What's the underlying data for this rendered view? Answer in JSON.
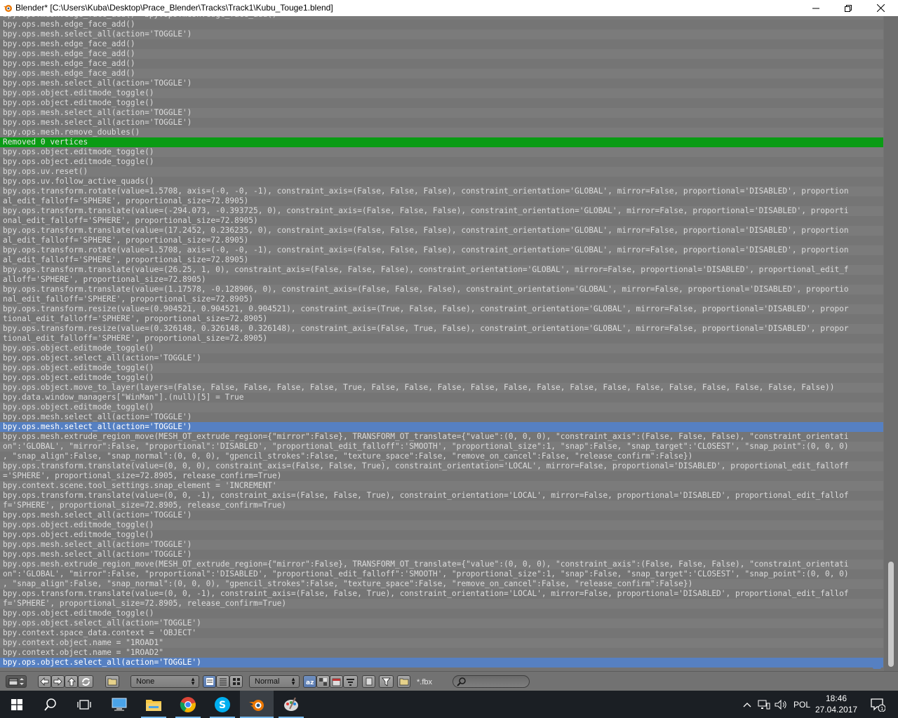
{
  "window": {
    "title": "Blender* [C:\\Users\\Kuba\\Desktop\\Prace_Blender\\Tracks\\Track1\\Kubu_Touge1.blend]"
  },
  "console": {
    "lines": [
      {
        "text": "bpy.ops.mesh.edge_face_add()  bpy.ops.mesh.edge_face_add()",
        "kind": "normal"
      },
      {
        "text": "bpy.ops.mesh.edge_face_add()",
        "kind": "normal"
      },
      {
        "text": "bpy.ops.mesh.select_all(action='TOGGLE')",
        "kind": "normal"
      },
      {
        "text": "bpy.ops.mesh.edge_face_add()",
        "kind": "normal"
      },
      {
        "text": "bpy.ops.mesh.edge_face_add()",
        "kind": "normal"
      },
      {
        "text": "bpy.ops.mesh.edge_face_add()",
        "kind": "normal"
      },
      {
        "text": "bpy.ops.mesh.edge_face_add()",
        "kind": "normal"
      },
      {
        "text": "bpy.ops.mesh.select_all(action='TOGGLE')",
        "kind": "normal"
      },
      {
        "text": "bpy.ops.object.editmode_toggle()",
        "kind": "normal"
      },
      {
        "text": "bpy.ops.object.editmode_toggle()",
        "kind": "normal"
      },
      {
        "text": "bpy.ops.mesh.select_all(action='TOGGLE')",
        "kind": "normal"
      },
      {
        "text": "bpy.ops.mesh.select_all(action='TOGGLE')",
        "kind": "normal"
      },
      {
        "text": "bpy.ops.mesh.remove_doubles()",
        "kind": "normal"
      },
      {
        "text": "Removed 0 vertices",
        "kind": "info"
      },
      {
        "text": "bpy.ops.object.editmode_toggle()",
        "kind": "normal"
      },
      {
        "text": "bpy.ops.object.editmode_toggle()",
        "kind": "normal"
      },
      {
        "text": "bpy.ops.uv.reset()",
        "kind": "normal"
      },
      {
        "text": "bpy.ops.uv.follow_active_quads()",
        "kind": "normal"
      },
      {
        "text": "bpy.ops.transform.rotate(value=1.5708, axis=(-0, -0, -1), constraint_axis=(False, False, False), constraint_orientation='GLOBAL', mirror=False, proportional='DISABLED', proportion",
        "kind": "normal"
      },
      {
        "text": "al_edit_falloff='SPHERE', proportional_size=72.8905)",
        "kind": "normal"
      },
      {
        "text": "bpy.ops.transform.translate(value=(-294.073, -0.393725, 0), constraint_axis=(False, False, False), constraint_orientation='GLOBAL', mirror=False, proportional='DISABLED', proporti",
        "kind": "normal"
      },
      {
        "text": "onal_edit_falloff='SPHERE', proportional_size=72.8905)",
        "kind": "normal"
      },
      {
        "text": "bpy.ops.transform.translate(value=(17.2452, 0.236235, 0), constraint_axis=(False, False, False), constraint_orientation='GLOBAL', mirror=False, proportional='DISABLED', proportion",
        "kind": "normal"
      },
      {
        "text": "al_edit_falloff='SPHERE', proportional_size=72.8905)",
        "kind": "normal"
      },
      {
        "text": "bpy.ops.transform.rotate(value=1.5708, axis=(-0, -0, -1), constraint_axis=(False, False, False), constraint_orientation='GLOBAL', mirror=False, proportional='DISABLED', proportion",
        "kind": "normal"
      },
      {
        "text": "al_edit_falloff='SPHERE', proportional_size=72.8905)",
        "kind": "normal"
      },
      {
        "text": "bpy.ops.transform.translate(value=(26.25, 1, 0), constraint_axis=(False, False, False), constraint_orientation='GLOBAL', mirror=False, proportional='DISABLED', proportional_edit_f",
        "kind": "normal"
      },
      {
        "text": "alloff='SPHERE', proportional_size=72.8905)",
        "kind": "normal"
      },
      {
        "text": "bpy.ops.transform.translate(value=(1.17578, -0.128906, 0), constraint_axis=(False, False, False), constraint_orientation='GLOBAL', mirror=False, proportional='DISABLED', proportio",
        "kind": "normal"
      },
      {
        "text": "nal_edit_falloff='SPHERE', proportional_size=72.8905)",
        "kind": "normal"
      },
      {
        "text": "bpy.ops.transform.resize(value=(0.904521, 0.904521, 0.904521), constraint_axis=(True, False, False), constraint_orientation='GLOBAL', mirror=False, proportional='DISABLED', propor",
        "kind": "normal"
      },
      {
        "text": "tional_edit_falloff='SPHERE', proportional_size=72.8905)",
        "kind": "normal"
      },
      {
        "text": "bpy.ops.transform.resize(value=(0.326148, 0.326148, 0.326148), constraint_axis=(False, True, False), constraint_orientation='GLOBAL', mirror=False, proportional='DISABLED', propor",
        "kind": "normal"
      },
      {
        "text": "tional_edit_falloff='SPHERE', proportional_size=72.8905)",
        "kind": "normal"
      },
      {
        "text": "bpy.ops.object.editmode_toggle()",
        "kind": "normal"
      },
      {
        "text": "bpy.ops.object.select_all(action='TOGGLE')",
        "kind": "normal"
      },
      {
        "text": "bpy.ops.object.editmode_toggle()",
        "kind": "normal"
      },
      {
        "text": "bpy.ops.object.editmode_toggle()",
        "kind": "normal"
      },
      {
        "text": "bpy.ops.object.move_to_layer(layers=(False, False, False, False, False, True, False, False, False, False, False, False, False, False, False, False, False, False, False, False))",
        "kind": "normal"
      },
      {
        "text": "bpy.data.window_managers[\"WinMan\"].(null)[5] = True",
        "kind": "normal"
      },
      {
        "text": "bpy.ops.object.editmode_toggle()",
        "kind": "normal"
      },
      {
        "text": "bpy.ops.mesh.select_all(action='TOGGLE')",
        "kind": "normal"
      },
      {
        "text": "bpy.ops.mesh.select_all(action='TOGGLE')",
        "kind": "sel"
      },
      {
        "text": "bpy.ops.mesh.extrude_region_move(MESH_OT_extrude_region={\"mirror\":False}, TRANSFORM_OT_translate={\"value\":(0, 0, 0), \"constraint_axis\":(False, False, False), \"constraint_orientati",
        "kind": "normal"
      },
      {
        "text": "on\":'GLOBAL', \"mirror\":False, \"proportional\":'DISABLED', \"proportional_edit_falloff\":'SMOOTH', \"proportional_size\":1, \"snap\":False, \"snap_target\":'CLOSEST', \"snap_point\":(0, 0, 0)",
        "kind": "normal"
      },
      {
        "text": ", \"snap_align\":False, \"snap_normal\":(0, 0, 0), \"gpencil_strokes\":False, \"texture_space\":False, \"remove_on_cancel\":False, \"release_confirm\":False})",
        "kind": "normal"
      },
      {
        "text": "bpy.ops.transform.translate(value=(0, 0, 0), constraint_axis=(False, False, True), constraint_orientation='LOCAL', mirror=False, proportional='DISABLED', proportional_edit_falloff",
        "kind": "normal"
      },
      {
        "text": "='SPHERE', proportional_size=72.8905, release_confirm=True)",
        "kind": "normal"
      },
      {
        "text": "bpy.context.scene.tool_settings.snap_element = 'INCREMENT'",
        "kind": "normal"
      },
      {
        "text": "bpy.ops.transform.translate(value=(0, 0, -1), constraint_axis=(False, False, True), constraint_orientation='LOCAL', mirror=False, proportional='DISABLED', proportional_edit_fallof",
        "kind": "normal"
      },
      {
        "text": "f='SPHERE', proportional_size=72.8905, release_confirm=True)",
        "kind": "normal"
      },
      {
        "text": "bpy.ops.mesh.select_all(action='TOGGLE')",
        "kind": "normal"
      },
      {
        "text": "bpy.ops.object.editmode_toggle()",
        "kind": "normal"
      },
      {
        "text": "bpy.ops.object.editmode_toggle()",
        "kind": "normal"
      },
      {
        "text": "bpy.ops.mesh.select_all(action='TOGGLE')",
        "kind": "normal"
      },
      {
        "text": "bpy.ops.mesh.select_all(action='TOGGLE')",
        "kind": "normal"
      },
      {
        "text": "bpy.ops.mesh.extrude_region_move(MESH_OT_extrude_region={\"mirror\":False}, TRANSFORM_OT_translate={\"value\":(0, 0, 0), \"constraint_axis\":(False, False, False), \"constraint_orientati",
        "kind": "normal"
      },
      {
        "text": "on\":'GLOBAL', \"mirror\":False, \"proportional\":'DISABLED', \"proportional_edit_falloff\":'SMOOTH', \"proportional_size\":1, \"snap\":False, \"snap_target\":'CLOSEST', \"snap_point\":(0, 0, 0)",
        "kind": "normal"
      },
      {
        "text": ", \"snap_align\":False, \"snap_normal\":(0, 0, 0), \"gpencil_strokes\":False, \"texture_space\":False, \"remove_on_cancel\":False, \"release_confirm\":False})",
        "kind": "normal"
      },
      {
        "text": "bpy.ops.transform.translate(value=(0, 0, -1), constraint_axis=(False, False, True), constraint_orientation='LOCAL', mirror=False, proportional='DISABLED', proportional_edit_fallof",
        "kind": "normal"
      },
      {
        "text": "f='SPHERE', proportional_size=72.8905, release_confirm=True)",
        "kind": "normal"
      },
      {
        "text": "bpy.ops.object.editmode_toggle()",
        "kind": "normal"
      },
      {
        "text": "bpy.ops.object.select_all(action='TOGGLE')",
        "kind": "normal"
      },
      {
        "text": "bpy.context.space_data.context = 'OBJECT'",
        "kind": "normal"
      },
      {
        "text": "bpy.context.object.name = \"1ROAD1\"",
        "kind": "normal"
      },
      {
        "text": "bpy.context.object.name = \"1ROAD2\"",
        "kind": "normal"
      },
      {
        "text": "bpy.ops.object.select_all(action='TOGGLE')",
        "kind": "sel"
      }
    ]
  },
  "toolbar": {
    "filter_type": "None",
    "display_mode": "Normal",
    "filter_glob": "*.fbx",
    "search_placeholder": ""
  },
  "taskbar": {
    "language": "POL",
    "time": "18:46",
    "date": "27.04.2017",
    "notification_count": "1"
  },
  "colors": {
    "info_line": "#0a9b14",
    "selected_line": "#5680c2",
    "console_bg": "#737373",
    "taskbar_bg": "#1b1f24"
  }
}
